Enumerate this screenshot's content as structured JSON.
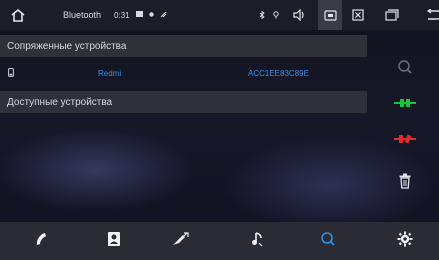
{
  "status_bar": {
    "app_title": "Bluetooth",
    "time": "0:31",
    "icons": {
      "home": "home-icon",
      "message": "message-icon",
      "record": "dot-icon",
      "signal": "signal-icon",
      "bluetooth": "bluetooth-icon",
      "location": "location-icon",
      "volume": "volume-icon",
      "screenshot": "screenshot-icon",
      "close": "close-box-icon",
      "windows": "windows-icon",
      "back": "back-icon"
    }
  },
  "paired": {
    "header": "Сопряженные устройства",
    "devices": [
      {
        "name": "Redmi",
        "address": "ACC1EE83C89E"
      }
    ]
  },
  "available": {
    "header": "Доступные устройства"
  },
  "side_panel": [
    "search-icon",
    "connect-icon",
    "disconnect-icon",
    "trash-icon"
  ],
  "bottom_bar": {
    "items": [
      "phone-icon",
      "contacts-icon",
      "dialpad-icon",
      "music-icon",
      "search-icon",
      "settings-icon"
    ],
    "active": "search-icon"
  },
  "colors": {
    "accent_blue": "#2d8fe8",
    "connect_green": "#19c43a",
    "disconnect_red": "#e22a2a"
  }
}
